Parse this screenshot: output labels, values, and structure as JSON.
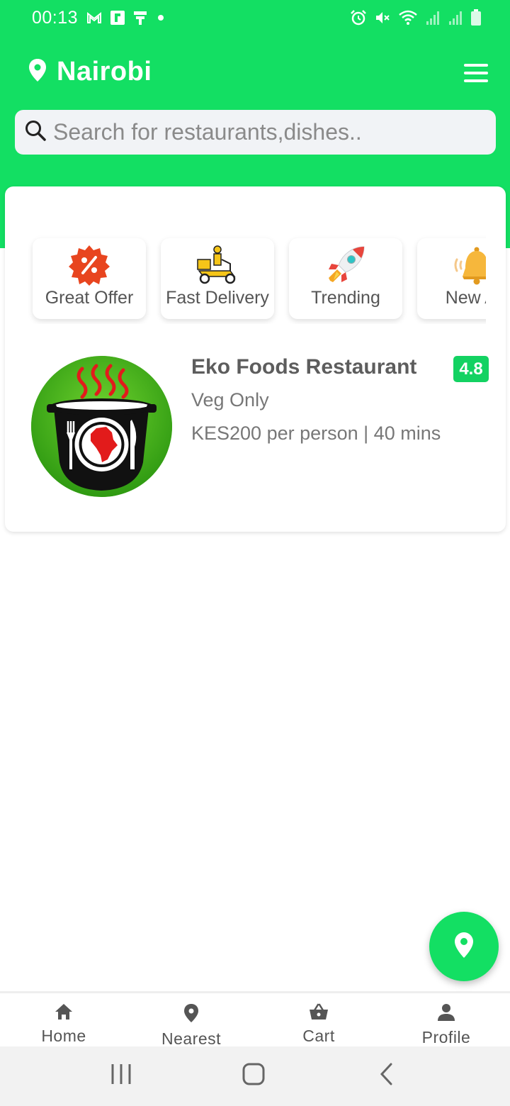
{
  "status_bar": {
    "time": "00:13",
    "left_icons": [
      "gmail-icon",
      "flipboard-icon",
      "app-icon",
      "dot-icon"
    ],
    "right_icons": [
      "alarm-icon",
      "mute-icon",
      "wifi-icon",
      "signal-icon",
      "signal-icon-2",
      "battery-icon"
    ]
  },
  "header": {
    "location_icon": "location-pin-icon",
    "city": "Nairobi",
    "menu_icon": "hamburger-menu-icon"
  },
  "search": {
    "placeholder": "Search for restaurants,dishes..",
    "value": ""
  },
  "categories": [
    {
      "label": "Great Offer",
      "icon": "discount-badge-icon"
    },
    {
      "label": "Fast Delivery",
      "icon": "delivery-scooter-icon"
    },
    {
      "label": "Trending",
      "icon": "rocket-icon"
    },
    {
      "label": "New Ar",
      "icon": "bell-icon"
    }
  ],
  "restaurant": {
    "name": "Eko Foods Restaurant",
    "rating": "4.8",
    "type": "Veg Only",
    "meta": "KES200 per person | 40 mins",
    "logo_icon": "restaurant-logo-pot-icon"
  },
  "fab": {
    "icon": "location-pin-icon"
  },
  "bottom_nav": [
    {
      "label": "Home",
      "icon": "home-icon"
    },
    {
      "label": "Nearest",
      "icon": "location-pin-icon"
    },
    {
      "label": "Cart",
      "icon": "basket-icon"
    },
    {
      "label": "Profile",
      "icon": "person-icon"
    }
  ],
  "system_nav": [
    "recents-button",
    "home-button",
    "back-button"
  ],
  "colors": {
    "brand_green": "#13df63",
    "rating_green": "#13d262",
    "text_gray": "#555555"
  }
}
